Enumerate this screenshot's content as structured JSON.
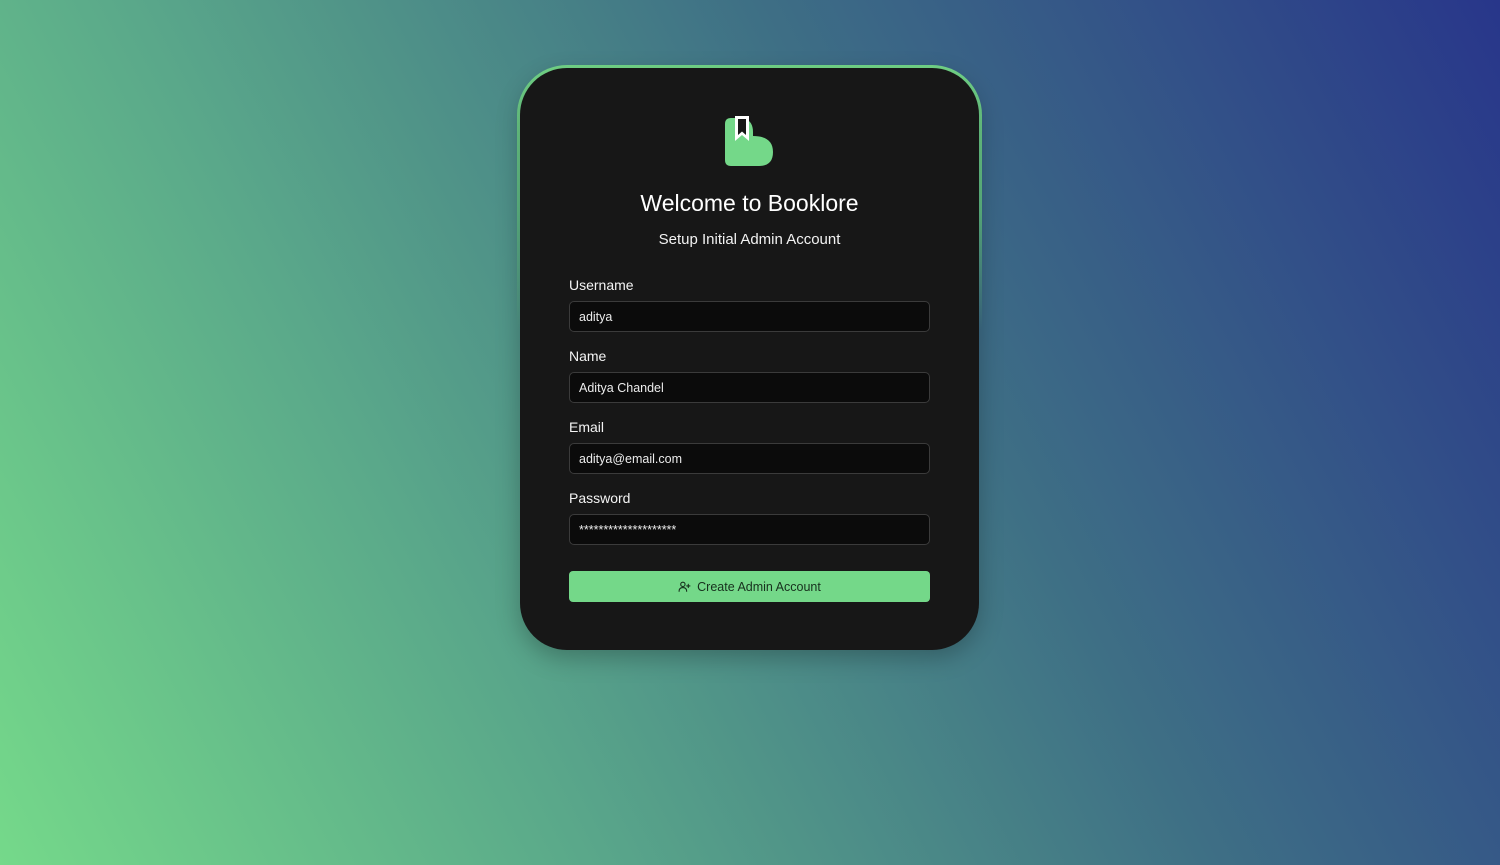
{
  "app": {
    "title": "Welcome to Booklore",
    "subtitle": "Setup Initial Admin Account",
    "accent_color": "#74d889",
    "logo_icon": "booklore-logo"
  },
  "form": {
    "username": {
      "label": "Username",
      "value": "aditya"
    },
    "name": {
      "label": "Name",
      "value": "Aditya Chandel"
    },
    "email": {
      "label": "Email",
      "value": "aditya@email.com"
    },
    "password": {
      "label": "Password",
      "value": "********************"
    },
    "submit": {
      "label": "Create Admin Account",
      "icon": "user-plus-icon"
    }
  }
}
